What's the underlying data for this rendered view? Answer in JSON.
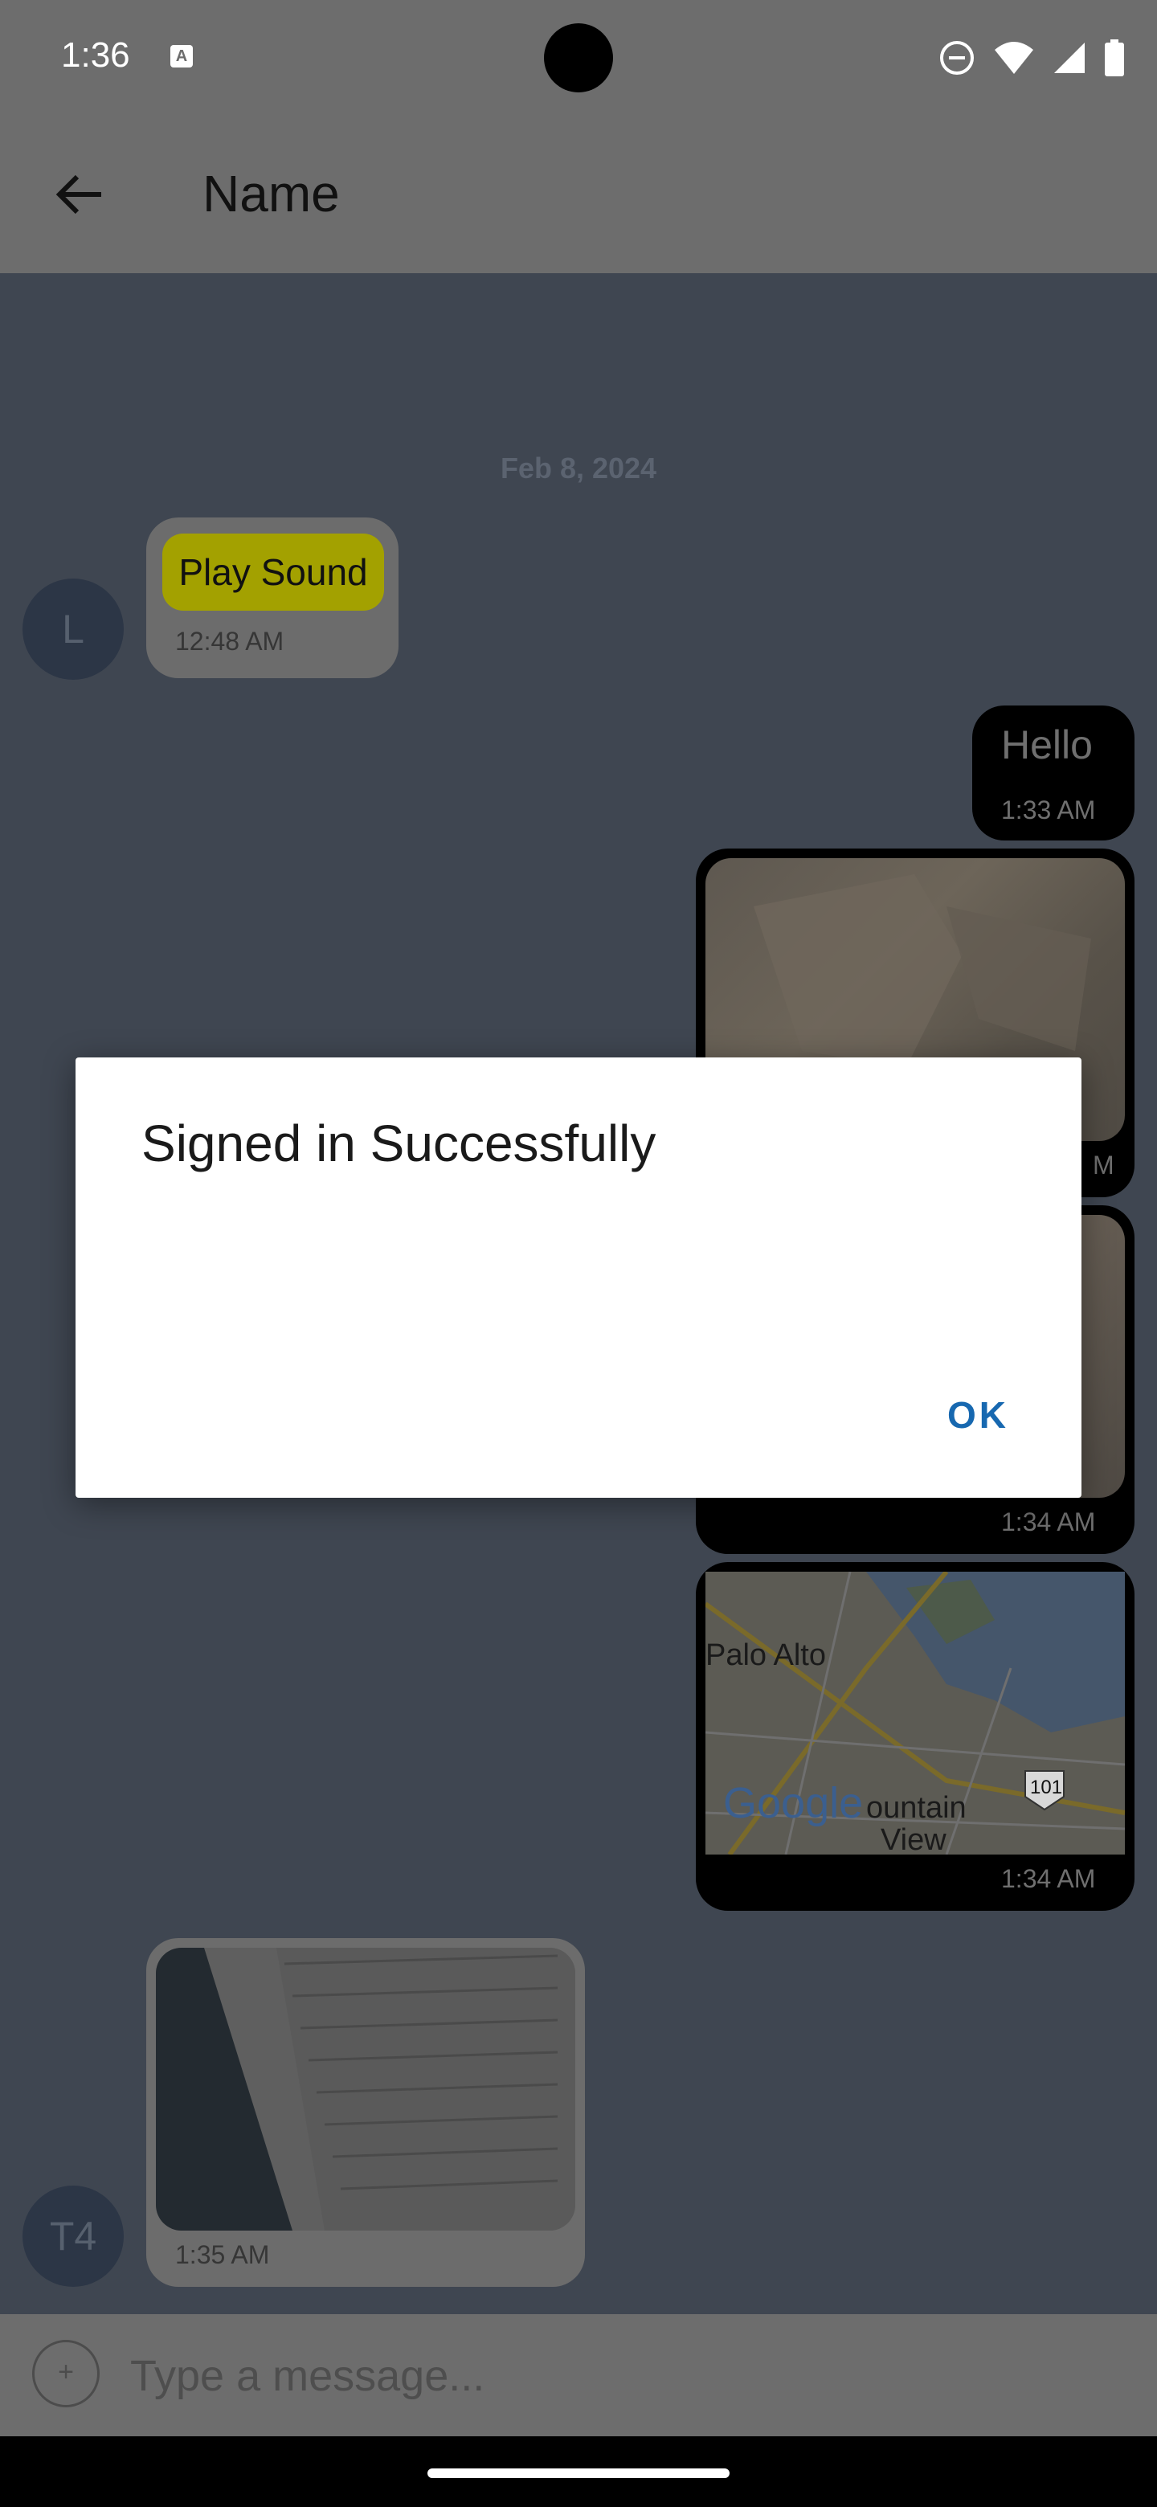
{
  "status_bar": {
    "time": "1:36",
    "notif_glyph": "A",
    "icons": [
      "dnd-icon",
      "wifi-icon",
      "cell-signal-icon",
      "battery-icon"
    ]
  },
  "app_bar": {
    "title": "Name"
  },
  "chat": {
    "date": "Feb 8, 2024",
    "messages": [
      {
        "type": "incoming",
        "avatar": "L",
        "button_label": "Play Sound",
        "time": "12:48 AM"
      },
      {
        "type": "outgoing",
        "text": "Hello",
        "time": "1:33 AM"
      },
      {
        "type": "outgoing-image",
        "time_partial": "M"
      },
      {
        "type": "outgoing-image",
        "time": "1:34 AM"
      },
      {
        "type": "outgoing-map",
        "time": "1:34 AM",
        "labels": [
          "Palo Alto",
          "Google",
          "ountain",
          "View",
          "101"
        ]
      },
      {
        "type": "incoming-image",
        "avatar": "T4",
        "time": "1:35 AM"
      }
    ]
  },
  "composer": {
    "placeholder": "Type a message...",
    "add_glyph": "+"
  },
  "dialog": {
    "title": "Signed in Successfully",
    "ok_label": "OK"
  },
  "colors": {
    "accent": "#1768b0",
    "scrim_bg": "#3f4651",
    "app_bar_dimmed": "#6d6d6d",
    "play_button": "#a3a100"
  }
}
